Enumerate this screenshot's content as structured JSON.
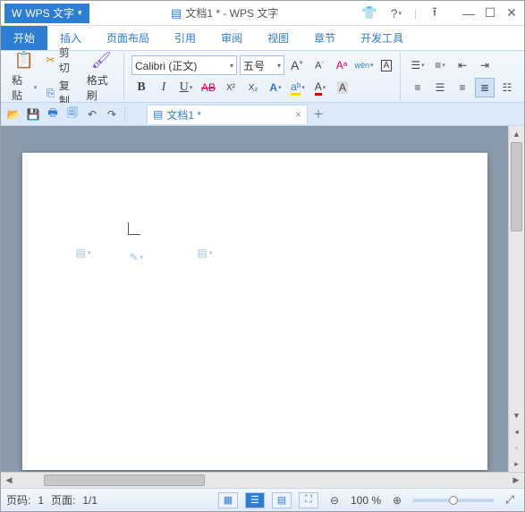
{
  "app": {
    "name": "WPS 文字",
    "title": "文档1 * - WPS 文字"
  },
  "tabs": [
    "开始",
    "插入",
    "页面布局",
    "引用",
    "审阅",
    "视图",
    "章节",
    "开发工具"
  ],
  "clipboard": {
    "paste": "粘贴",
    "cut": "剪切",
    "copy": "复制",
    "format_painter": "格式刷"
  },
  "font": {
    "family": "Calibri (正文)",
    "size": "五号",
    "grow": "A",
    "shrink": "A",
    "clear": "A",
    "phonetic": "wén",
    "charborder": "A"
  },
  "doc_tab": {
    "name": "文档1 *"
  },
  "status": {
    "page_label": "页码:",
    "page": "1",
    "total_label": "页面:",
    "total": "1/1",
    "zoom": "100 %"
  }
}
